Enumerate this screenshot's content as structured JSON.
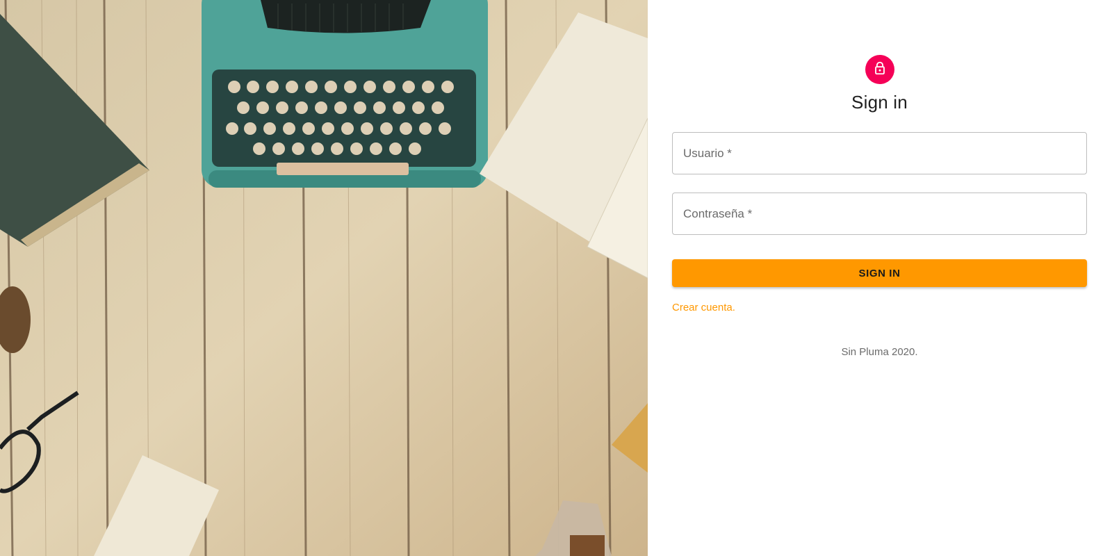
{
  "background": {
    "icons": [
      "typewriter-icon",
      "book-icon",
      "notebook-icon",
      "glasses-icon",
      "pinecone-icon",
      "paper-icon",
      "ink-bottle-icon"
    ]
  },
  "signin": {
    "icon": "lock-icon",
    "title": "Sign in",
    "username_label": "Usuario *",
    "password_label": "Contraseña *",
    "submit_label": "SIGN IN",
    "create_account_label": "Crear cuenta.",
    "footer": "Sin Pluma 2020."
  },
  "colors": {
    "accent": "#ff9800",
    "avatar": "#f50057"
  }
}
